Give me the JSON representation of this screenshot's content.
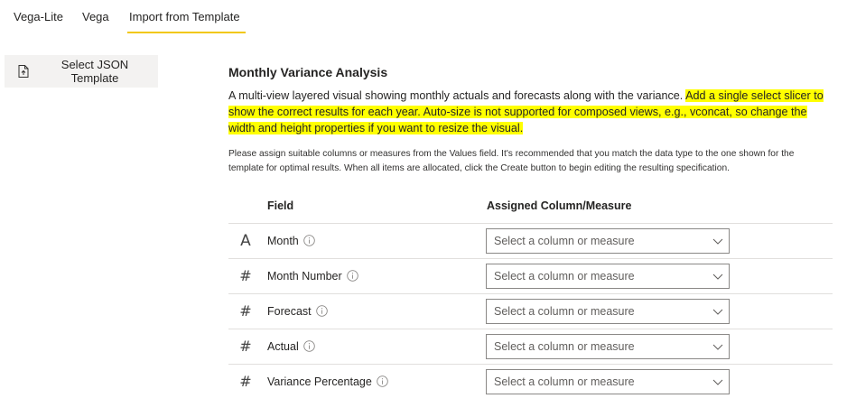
{
  "tabs": [
    {
      "label": "Vega-Lite",
      "active": false
    },
    {
      "label": "Vega",
      "active": false
    },
    {
      "label": "Import from Template",
      "active": true
    }
  ],
  "colors": {
    "accent_underline": "#f2c811",
    "highlight": "#ffff00",
    "button_bg": "#f3f2f1",
    "border": "#8a8886"
  },
  "sidebar": {
    "select_json_button": {
      "label": "Select JSON Template",
      "icon": "file-upload-icon"
    }
  },
  "template": {
    "title": "Monthly Variance Analysis",
    "description_plain": "A multi-view layered visual showing monthly actuals and forecasts along with the variance. ",
    "description_highlight": "Add a single select slicer to show the correct results for each year. Auto-size is not supported for composed views, e.g., vconcat, so change the width and height properties if you want to resize the visual.",
    "note": "Please assign suitable columns or measures from the Values field. It's recommended that you match the data type to the one shown for the template for optimal results. When all items are allocated, click the Create button to begin editing the resulting specification."
  },
  "table": {
    "headers": {
      "field": "Field",
      "assigned": "Assigned Column/Measure"
    },
    "rows": [
      {
        "type_icon": "A",
        "type": "text",
        "field": "Month",
        "placeholder": "Select a column or measure"
      },
      {
        "type_icon": "#",
        "type": "number",
        "field": "Month Number",
        "placeholder": "Select a column or measure"
      },
      {
        "type_icon": "#",
        "type": "number",
        "field": "Forecast",
        "placeholder": "Select a column or measure"
      },
      {
        "type_icon": "#",
        "type": "number",
        "field": "Actual",
        "placeholder": "Select a column or measure"
      },
      {
        "type_icon": "#",
        "type": "number",
        "field": "Variance Percentage",
        "placeholder": "Select a column or measure"
      }
    ]
  }
}
